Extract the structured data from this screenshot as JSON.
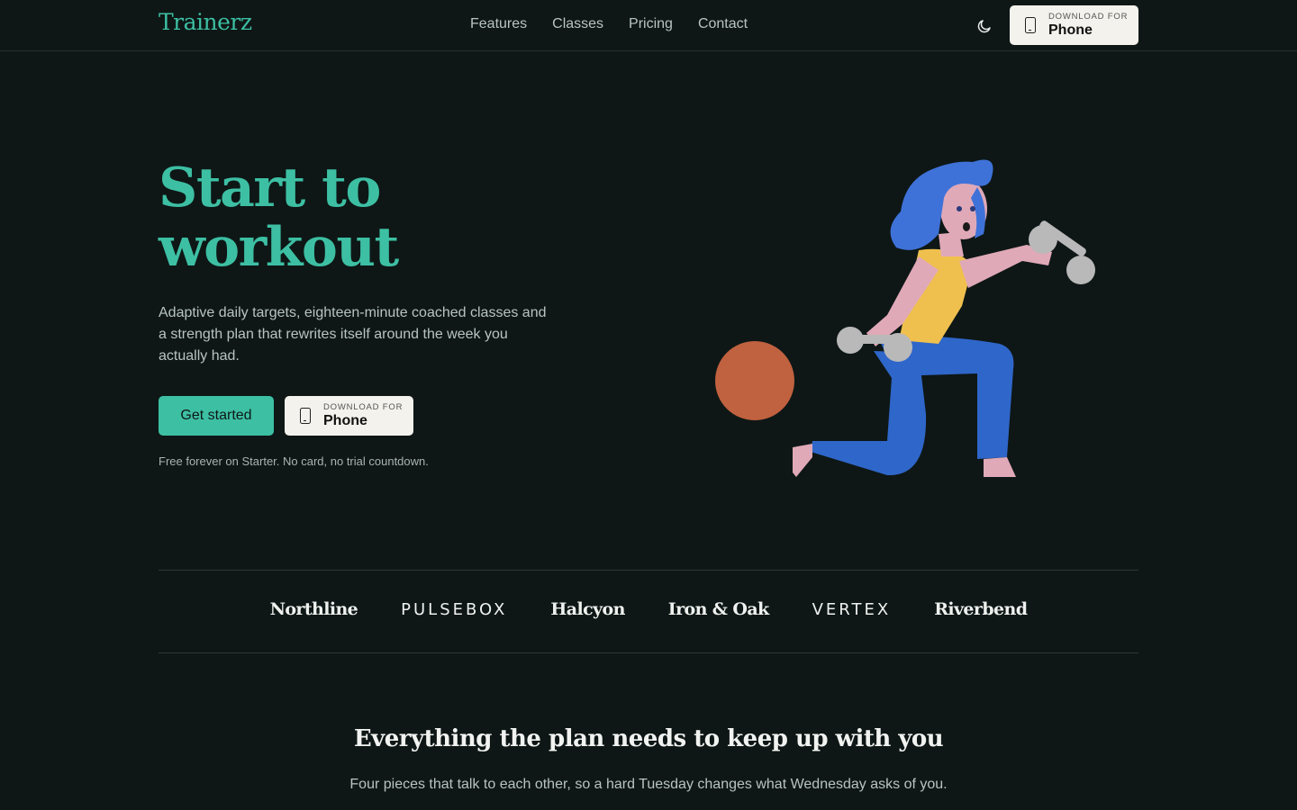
{
  "header": {
    "logo": "Trainerz",
    "nav": [
      "Features",
      "Classes",
      "Pricing",
      "Contact"
    ],
    "theme_icon": "moon-icon",
    "download": {
      "small": "DOWNLOAD FOR",
      "big": "Phone",
      "icon": "phone-icon"
    }
  },
  "hero": {
    "title_line1": "Start to",
    "title_line2": "workout",
    "description": "Adaptive daily targets, eighteen-minute coached classes and a strength plan that rewrites itself around the week you actually had.",
    "cta": "Get started",
    "download": {
      "small": "DOWNLOAD FOR",
      "big": "Phone"
    },
    "footnote": "Free forever on Starter. No card, no trial countdown."
  },
  "brands": [
    "Northline",
    "PULSEBOX",
    "Halcyon",
    "Iron & Oak",
    "VERTEX",
    "Riverbend"
  ],
  "features_section": {
    "title": "Everything the plan needs to keep up with you",
    "subtitle": "Four pieces that talk to each other, so a hard Tuesday changes what Wednesday asks of you."
  },
  "colors": {
    "background": "#0e1716",
    "accent": "#3dbfa3",
    "button_light": "#f4f2ec"
  }
}
